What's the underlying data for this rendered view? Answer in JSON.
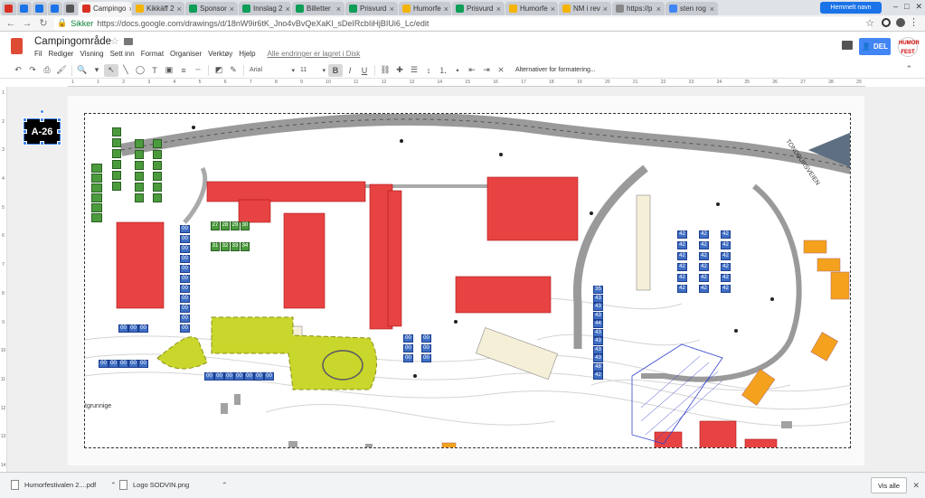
{
  "browser": {
    "tabs": [
      {
        "label": "",
        "color": "#d93025"
      },
      {
        "label": "",
        "color": "#1a73e8"
      },
      {
        "label": "",
        "color": "#1a73e8"
      },
      {
        "label": "",
        "color": "#1a73e8"
      },
      {
        "label": "",
        "color": "#555"
      },
      {
        "label": "Campingo",
        "color": "#d93025",
        "active": true
      },
      {
        "label": "Kikkäff 2",
        "color": "#f4b400"
      },
      {
        "label": "Sponsor",
        "color": "#0f9d58"
      },
      {
        "label": "Innslag 2",
        "color": "#0f9d58"
      },
      {
        "label": "Billetter",
        "color": "#0f9d58"
      },
      {
        "label": "Prisvurd",
        "color": "#0f9d58"
      },
      {
        "label": "Humorfe",
        "color": "#f4b400"
      },
      {
        "label": "Prisvurd",
        "color": "#0f9d58"
      },
      {
        "label": "Humorfe",
        "color": "#f4b400"
      },
      {
        "label": "NM i rev",
        "color": "#f4b400"
      },
      {
        "label": "https://p",
        "color": "#888"
      },
      {
        "label": "sten rog",
        "color": "#4285f4"
      }
    ],
    "profile": "Hemmelt navn",
    "secure_label": "Sikker",
    "url": "https://docs.google.com/drawings/d/18nW9ir6tK_Jno4vBvQeXaKl_sDeIRcbIiHjBIUi6_Lc/edit"
  },
  "doc": {
    "title": "Campingområde",
    "menu": [
      "Fil",
      "Rediger",
      "Visning",
      "Sett inn",
      "Format",
      "Organiser",
      "Verktøy",
      "Hjelp"
    ],
    "saved_status": "Alle endringer er lagret i Disk",
    "share_label": "DEL",
    "user_logo": "HUMOR FEST"
  },
  "toolbar": {
    "font": "Arial",
    "size": "11",
    "bold": "B",
    "italic": "I",
    "underline": "U",
    "more_format": "Alternativer for formatering..."
  },
  "ruler": {
    "h_ticks": [
      "1",
      "1",
      "2",
      "3",
      "4",
      "5",
      "6",
      "7",
      "8",
      "9",
      "10",
      "11",
      "12",
      "13",
      "14",
      "15",
      "16",
      "17",
      "18",
      "19",
      "20",
      "21",
      "22",
      "23",
      "24",
      "25",
      "26",
      "27",
      "28",
      "29"
    ],
    "v_ticks": [
      "1",
      "2",
      "3",
      "4",
      "5",
      "6",
      "7",
      "8",
      "9",
      "10",
      "11",
      "12",
      "13",
      "14"
    ]
  },
  "selected_label": "A-26",
  "map": {
    "road_name": "TONDBURSVEIEN",
    "bottom_label": "tgrunnige",
    "green_tents": [
      [
        "27",
        "28",
        "29",
        "30"
      ],
      [
        "31",
        "32",
        "33",
        "34"
      ]
    ],
    "blue_rows": {
      "col_left": [
        "00",
        "00",
        "00",
        "00",
        "00",
        "00",
        "00",
        "00",
        "00",
        "00",
        "00"
      ],
      "row_mid": [
        "00",
        "00",
        "00"
      ],
      "row_bottom_left": [
        "00",
        "00",
        "00",
        "00",
        "00"
      ],
      "row_bottom": [
        "00",
        "00",
        "00",
        "00",
        "00",
        "00",
        "00"
      ],
      "pair_center": [
        "00",
        "00",
        "00",
        "00",
        "00",
        "00"
      ],
      "col_43": [
        "35",
        "43",
        "43",
        "43",
        "44",
        "43",
        "43",
        "43",
        "43",
        "48",
        "42"
      ],
      "grid_42": [
        "42",
        "42",
        "42",
        "42",
        "42",
        "42",
        "42",
        "42",
        "42",
        "42",
        "42",
        "42",
        "42",
        "42",
        "42",
        "42",
        "42",
        "42"
      ]
    }
  },
  "downloads": [
    {
      "name": "Humorfestivalen 2....pdf"
    },
    {
      "name": "Logo SODVIN.png"
    }
  ],
  "show_all": "Vis alle"
}
